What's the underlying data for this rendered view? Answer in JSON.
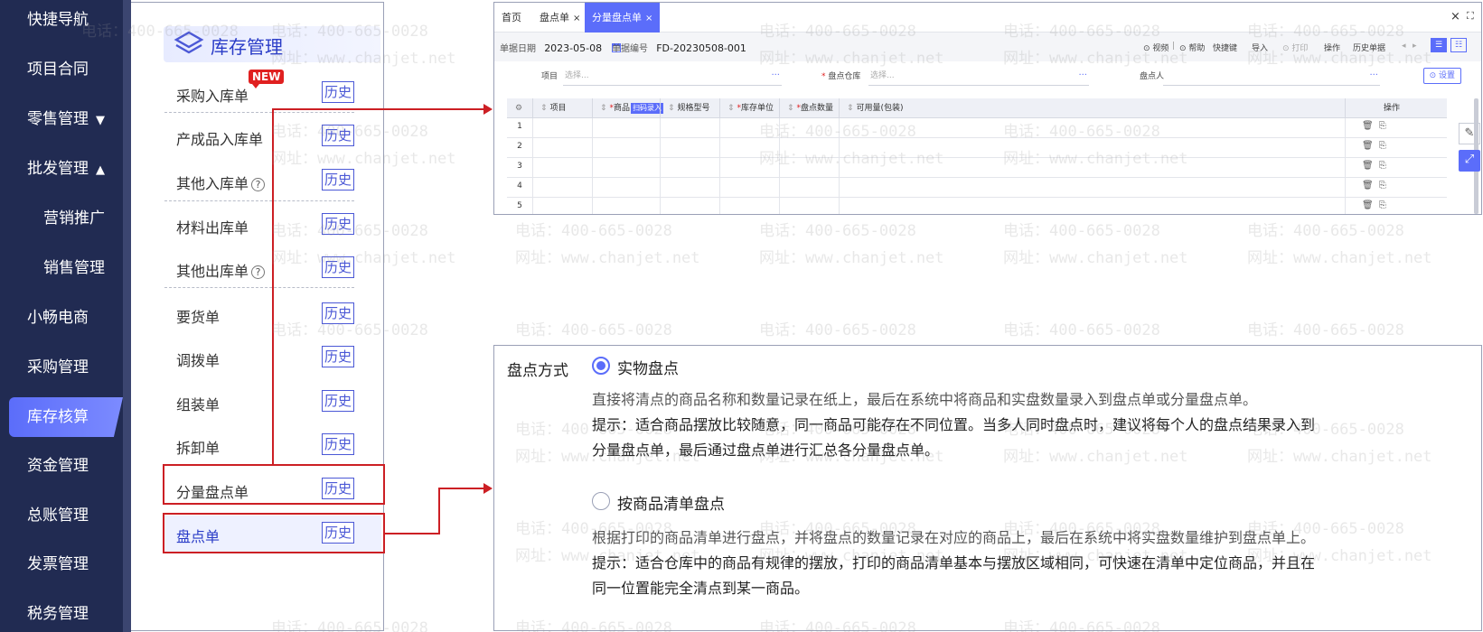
{
  "left_nav": {
    "items": [
      {
        "label": "快捷导航"
      },
      {
        "label": "项目合同"
      },
      {
        "label": "零售管理",
        "caret": "▼"
      },
      {
        "label": "批发管理",
        "caret": "▲"
      },
      {
        "label": "营销推广"
      },
      {
        "label": "销售管理"
      },
      {
        "label": "小畅电商"
      },
      {
        "label": "采购管理"
      },
      {
        "label": "库存核算",
        "active": true
      },
      {
        "label": "资金管理"
      },
      {
        "label": "总账管理"
      },
      {
        "label": "发票管理"
      },
      {
        "label": "税务管理"
      }
    ]
  },
  "submenu": {
    "title": "库存管理",
    "new_badge": "NEW",
    "history_label": "历史",
    "qmark": "?",
    "items": [
      {
        "label": "采购入库单"
      },
      {
        "label": "产成品入库单"
      },
      {
        "label": "其他入库单"
      },
      {
        "label": "材料出库单"
      },
      {
        "label": "其他出库单"
      },
      {
        "label": "要货单"
      },
      {
        "label": "调拨单"
      },
      {
        "label": "组装单"
      },
      {
        "label": "拆卸单"
      },
      {
        "label": "分量盘点单"
      },
      {
        "label": "盘点单"
      }
    ]
  },
  "app_window": {
    "tabs": [
      {
        "label": "首页"
      },
      {
        "label": "盘点单",
        "close": "×"
      },
      {
        "label": "分量盘点单",
        "close": "×",
        "active": true
      }
    ],
    "close_label": "×",
    "fullscreen_label": "⛶",
    "header": {
      "date_label": "单据日期",
      "date_value": "2023-05-08",
      "number_label": "单据编号",
      "number_value": "FD-20230508-001"
    },
    "toolbar": [
      "⊙ 视频",
      "|",
      "⊙ 帮助",
      "快捷键",
      "导入",
      "⊙ 打印",
      "操作",
      "历史单据"
    ],
    "form": {
      "project_label": "项目",
      "project_placeholder": "选择...",
      "warehouse_label": "盘点仓库",
      "warehouse_placeholder": "选择...",
      "person_label": "盘点人",
      "more": "···",
      "settings_label": "⊙ 设置"
    },
    "grid": {
      "columns": [
        {
          "label": "项目",
          "required": false
        },
        {
          "label": "商品",
          "required": true,
          "tag": "扫码录入"
        },
        {
          "label": "规格型号",
          "required": false
        },
        {
          "label": "库存单位",
          "required": true
        },
        {
          "label": "盘点数量",
          "required": true
        },
        {
          "label": "可用量(包装)",
          "required": false
        }
      ],
      "op_label": "操作",
      "rows": [
        "1",
        "2",
        "3",
        "4",
        "5"
      ],
      "req_mark": "*",
      "sort_mark": "⇕",
      "gear": "⚙",
      "row_icons": "🗑⎘"
    }
  },
  "method_panel": {
    "label": "盘点方式",
    "options": [
      {
        "title": "实物盘点",
        "selected": true,
        "lines": [
          "直接将清点的商品名称和数量记录在纸上，最后在系统中将商品和实盘数量录入到盘点单或分量盘点单。",
          "提示：适合商品摆放比较随意，同一商品可能存在不同位置。当多人同时盘点时，建议将每个人的盘点结果录入到",
          "分量盘点单，最后通过盘点单进行汇总各分量盘点单。"
        ]
      },
      {
        "title": "按商品清单盘点",
        "selected": false,
        "lines": [
          "根据打印的商品清单进行盘点，并将盘点的数量记录在对应的商品上，最后在系统中将实盘数量维护到盘点单上。",
          "提示：适合仓库中的商品有规律的摆放，打印的商品清单基本与摆放区域相同，可快速在清单中定位商品，并且在",
          "同一位置能完全清点到某一商品。"
        ]
      }
    ]
  },
  "watermark": {
    "phone": "电话：400-665-0028",
    "site": "网址：www.chanjet.net"
  },
  "colors": {
    "nav_bg": "#212b52",
    "accent": "#5b6dfa",
    "highlight_red": "#cc1f24"
  }
}
